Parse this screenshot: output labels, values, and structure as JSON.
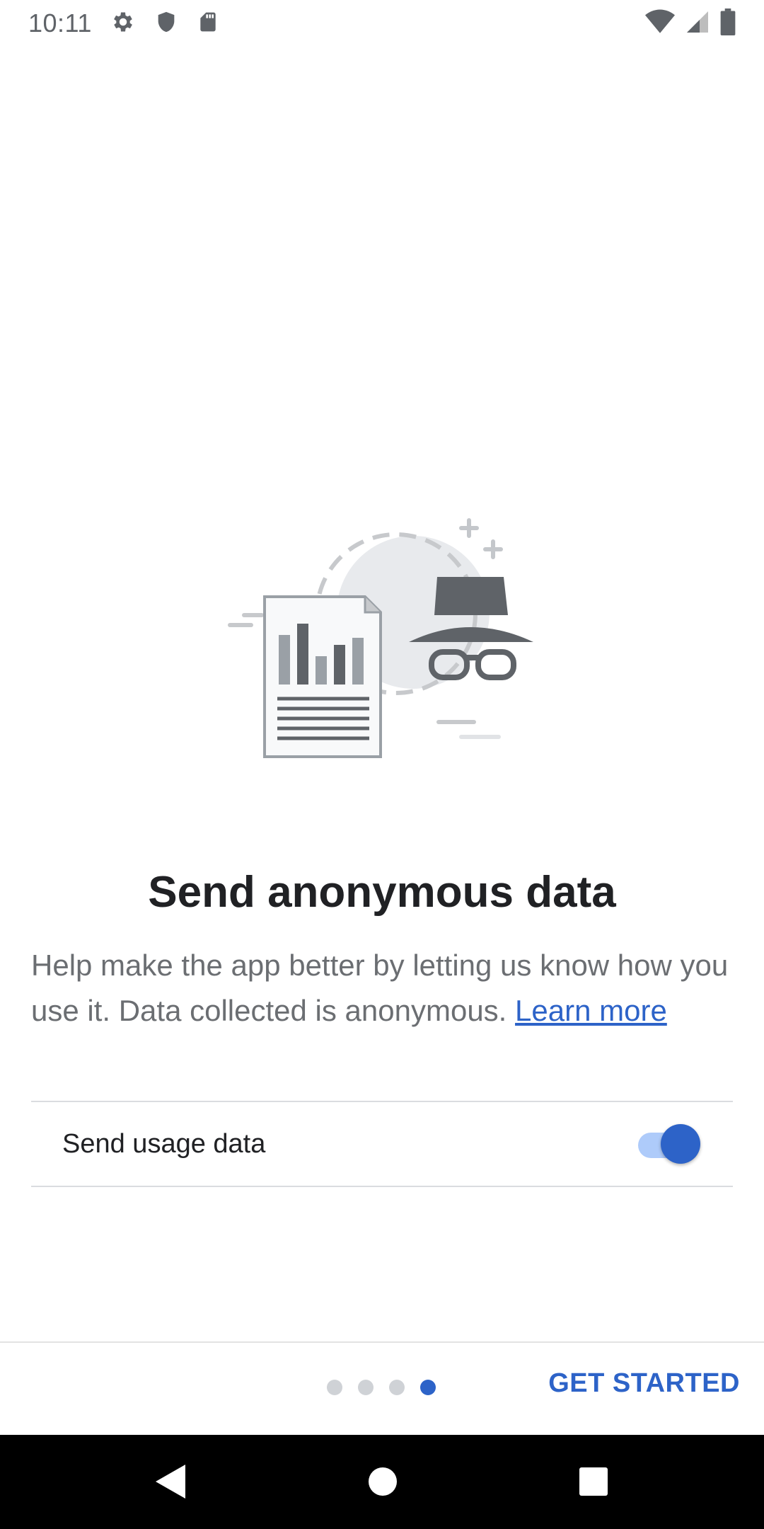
{
  "status_bar": {
    "time": "10:11",
    "icons": [
      "settings-icon",
      "shield-icon",
      "sd-card-icon",
      "wifi-icon",
      "signal-icon",
      "battery-icon"
    ]
  },
  "content": {
    "title": "Send anonymous data",
    "description": "Help make the app better by letting us know how you use it. Data collected is anonymous. ",
    "learn_more": "Learn more"
  },
  "setting": {
    "label": "Send usage data",
    "enabled": true
  },
  "pager": {
    "total": 4,
    "current": 4
  },
  "footer": {
    "get_started": "GET STARTED"
  },
  "colors": {
    "accent": "#2d63c8",
    "text_primary": "#202124",
    "text_secondary": "#6b6e72"
  },
  "nav": {
    "buttons": [
      "back-icon",
      "home-icon",
      "recents-icon"
    ]
  }
}
